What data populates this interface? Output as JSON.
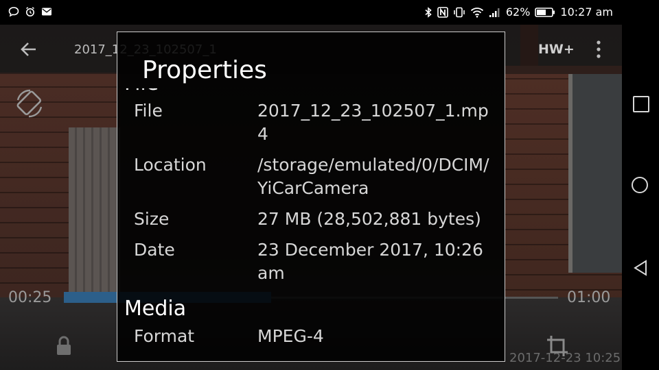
{
  "status_bar": {
    "battery": "62%",
    "time": "10:27 am",
    "left_icons": [
      "chat-icon",
      "alarm-icon",
      "mail-icon"
    ],
    "right_icons": [
      "bluetooth-icon",
      "nfc-icon",
      "vibrate-icon",
      "wifi-icon",
      "signal-icon",
      "battery-icon"
    ]
  },
  "player": {
    "title": "2017_12_23_102507_1",
    "hw_label": "HW+",
    "time_current": "00:25",
    "time_total": "01:00",
    "progress_fraction": 0.42,
    "overlay_stamp": "2017-12-23 10:25"
  },
  "dialog": {
    "title": "Properties",
    "sections": [
      {
        "heading": "File",
        "rows": [
          {
            "key": "File",
            "value": "2017_12_23_102507_1.mp4"
          },
          {
            "key": "Location",
            "value": "/storage/emulated/0/DCIM/YiCarCamera"
          },
          {
            "key": "Size",
            "value": "27 MB (28,502,881 bytes)"
          },
          {
            "key": "Date",
            "value": "23 December 2017, 10:26 am"
          }
        ]
      },
      {
        "heading": "Media",
        "rows": [
          {
            "key": "Format",
            "value": "MPEG-4"
          }
        ]
      }
    ]
  },
  "colors": {
    "seek_fill": "#2c5f8a",
    "dialog_border": "#cfcfcf"
  }
}
